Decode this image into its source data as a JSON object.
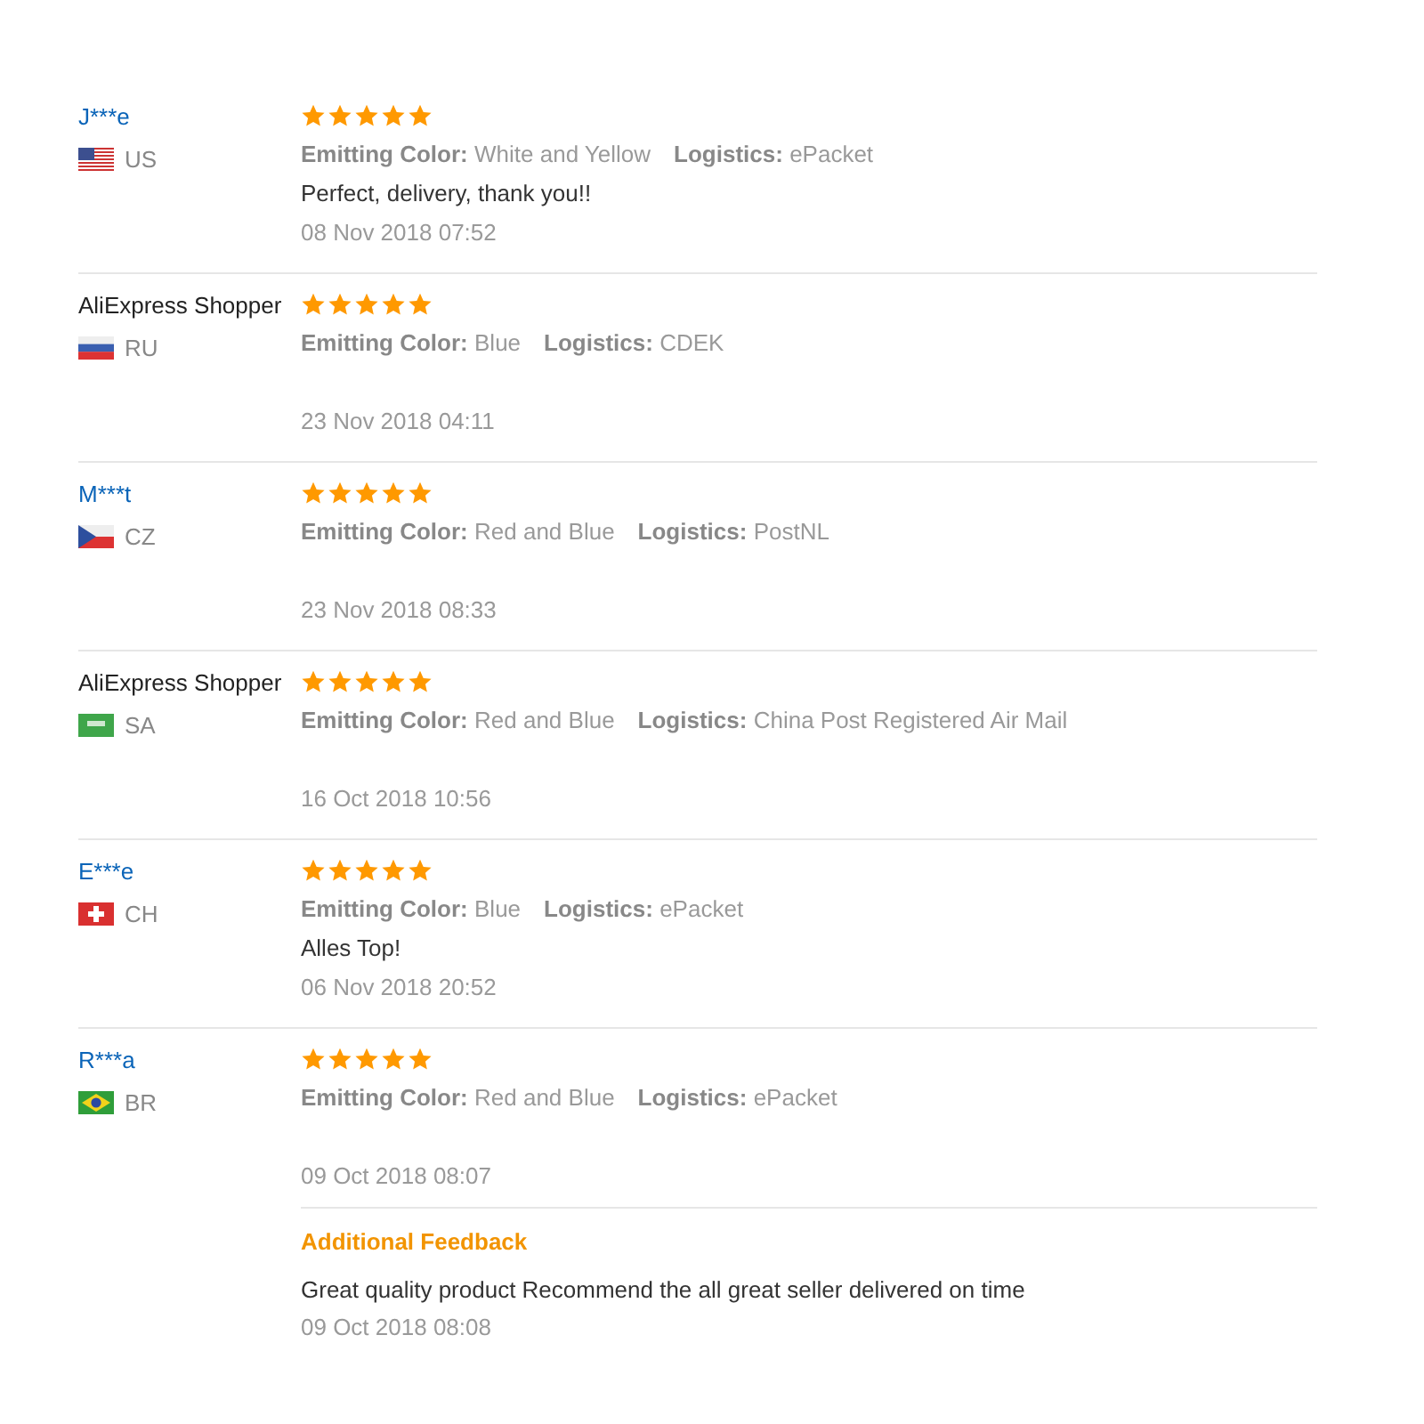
{
  "reviews": [
    {
      "name": "J***e",
      "linked": true,
      "flag": {
        "kind": "us"
      },
      "country": "US",
      "stars": 5,
      "meta": [
        {
          "label": "Emitting Color:",
          "value": "White and Yellow"
        },
        {
          "label": "Logistics:",
          "value": "ePacket"
        }
      ],
      "comment": "Perfect, delivery, thank you!!",
      "date": "08 Nov 2018 07:52"
    },
    {
      "name": "AliExpress Shopper",
      "linked": false,
      "flag": {
        "kind": "ru"
      },
      "country": "RU",
      "stars": 5,
      "meta": [
        {
          "label": "Emitting Color:",
          "value": "Blue"
        },
        {
          "label": "Logistics:",
          "value": "CDEK"
        }
      ],
      "date": "23 Nov 2018 04:11"
    },
    {
      "name": "M***t",
      "linked": true,
      "flag": {
        "kind": "cz"
      },
      "country": "CZ",
      "stars": 5,
      "meta": [
        {
          "label": "Emitting Color:",
          "value": "Red and Blue"
        },
        {
          "label": "Logistics:",
          "value": "PostNL"
        }
      ],
      "date": "23 Nov 2018 08:33"
    },
    {
      "name": "AliExpress Shopper",
      "linked": false,
      "flag": {
        "kind": "sa"
      },
      "country": "SA",
      "stars": 5,
      "meta": [
        {
          "label": "Emitting Color:",
          "value": "Red and Blue"
        },
        {
          "label": "Logistics:",
          "value": "China Post Registered Air Mail"
        }
      ],
      "date": "16 Oct 2018 10:56"
    },
    {
      "name": "E***e",
      "linked": true,
      "flag": {
        "kind": "ch"
      },
      "country": "CH",
      "stars": 5,
      "meta": [
        {
          "label": "Emitting Color:",
          "value": "Blue"
        },
        {
          "label": "Logistics:",
          "value": "ePacket"
        }
      ],
      "comment": "Alles Top!",
      "date": "06 Nov 2018 20:52"
    },
    {
      "name": "R***a",
      "linked": true,
      "flag": {
        "kind": "br"
      },
      "country": "BR",
      "stars": 5,
      "meta": [
        {
          "label": "Emitting Color:",
          "value": "Red and Blue"
        },
        {
          "label": "Logistics:",
          "value": "ePacket"
        }
      ],
      "date": "09 Oct 2018 08:07",
      "additional": {
        "title": "Additional Feedback",
        "text": "Great quality product Recommend the all great seller delivered on time",
        "date": "09 Oct 2018 08:08"
      }
    }
  ]
}
